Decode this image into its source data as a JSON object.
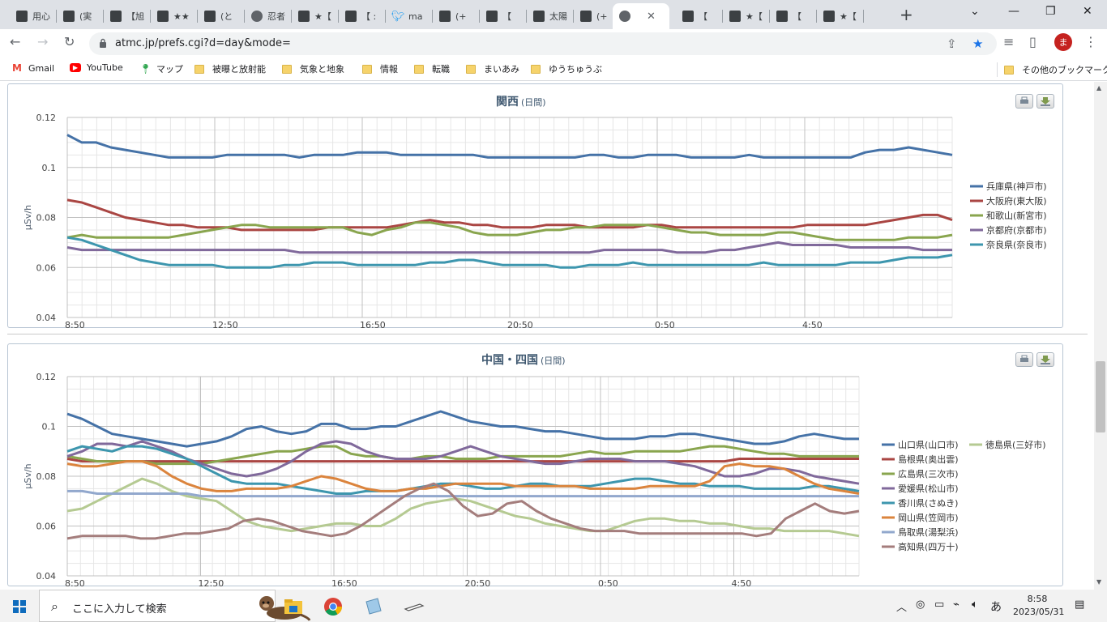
{
  "browser": {
    "tabs": [
      {
        "title": "用心",
        "icon": "site-icon"
      },
      {
        "title": "(実",
        "icon": "site-icon"
      },
      {
        "title": "【旭",
        "icon": "site-icon"
      },
      {
        "title": "★★",
        "icon": "site-icon"
      },
      {
        "title": "(と",
        "icon": "site-icon"
      },
      {
        "title": "忍者",
        "icon": "globe-icon"
      },
      {
        "title": "★【",
        "icon": "site-icon"
      },
      {
        "title": "【 :",
        "icon": "site-icon"
      },
      {
        "title": "ma",
        "icon": "twitter-icon"
      },
      {
        "title": "(+",
        "icon": "site-icon"
      },
      {
        "title": "【",
        "icon": "site-icon"
      },
      {
        "title": "太陽",
        "icon": "site-icon"
      },
      {
        "title": "(+",
        "icon": "site-icon"
      },
      {
        "title": "",
        "icon": "globe-icon",
        "active": true
      },
      {
        "title": "【",
        "icon": "site-icon"
      },
      {
        "title": "★【",
        "icon": "site-icon"
      },
      {
        "title": "【",
        "icon": "site-icon"
      },
      {
        "title": "★【",
        "icon": "site-icon"
      }
    ],
    "url": "atmc.jp/prefs.cgi?d=day&mode=",
    "avatar_initial": "ま",
    "bookmarks": [
      {
        "label": "Gmail",
        "icon": "gmail-icon"
      },
      {
        "label": "YouTube",
        "icon": "youtube-icon"
      },
      {
        "label": "マップ",
        "icon": "maps-icon"
      },
      {
        "label": "被曝と放射能",
        "icon": "folder-icon"
      },
      {
        "label": "気象と地象",
        "icon": "folder-icon"
      },
      {
        "label": "情報",
        "icon": "folder-icon"
      },
      {
        "label": "転職",
        "icon": "folder-icon"
      },
      {
        "label": "まいあみ",
        "icon": "folder-icon"
      },
      {
        "label": "ゆうちゅうぶ",
        "icon": "folder-icon"
      }
    ],
    "other_bookmarks": "その他のブックマーク"
  },
  "chart_data": [
    {
      "type": "line",
      "title": "関西",
      "subtitle": "(日間)",
      "ylabel": "μSv/h",
      "ylim": [
        0.04,
        0.12
      ],
      "yticks": [
        "0.12",
        "0.1",
        "0.08",
        "0.06",
        "0.04"
      ],
      "xticks": [
        "8:50",
        "12:50",
        "16:50",
        "20:50",
        "0:50",
        "4:50"
      ],
      "grid": true,
      "legend": "right",
      "series": [
        {
          "name": "兵庫県(神戸市)",
          "color": "#4572a7",
          "values": [
            0.113,
            0.11,
            0.11,
            0.108,
            0.107,
            0.106,
            0.105,
            0.104,
            0.104,
            0.104,
            0.104,
            0.105,
            0.105,
            0.105,
            0.105,
            0.105,
            0.104,
            0.105,
            0.105,
            0.105,
            0.106,
            0.106,
            0.106,
            0.105,
            0.105,
            0.105,
            0.105,
            0.105,
            0.105,
            0.104,
            0.104,
            0.104,
            0.104,
            0.104,
            0.104,
            0.104,
            0.105,
            0.105,
            0.104,
            0.104,
            0.105,
            0.105,
            0.105,
            0.104,
            0.104,
            0.104,
            0.104,
            0.105,
            0.104,
            0.104,
            0.104,
            0.104,
            0.104,
            0.104,
            0.104,
            0.106,
            0.107,
            0.107,
            0.108,
            0.107,
            0.106,
            0.105
          ]
        },
        {
          "name": "大阪府(東大阪)",
          "color": "#aa4643",
          "values": [
            0.087,
            0.086,
            0.084,
            0.082,
            0.08,
            0.079,
            0.078,
            0.077,
            0.077,
            0.076,
            0.076,
            0.076,
            0.075,
            0.075,
            0.075,
            0.075,
            0.075,
            0.075,
            0.076,
            0.076,
            0.076,
            0.076,
            0.076,
            0.077,
            0.078,
            0.079,
            0.078,
            0.078,
            0.077,
            0.077,
            0.076,
            0.076,
            0.076,
            0.077,
            0.077,
            0.077,
            0.076,
            0.076,
            0.076,
            0.076,
            0.077,
            0.077,
            0.076,
            0.076,
            0.076,
            0.076,
            0.076,
            0.076,
            0.076,
            0.076,
            0.076,
            0.077,
            0.077,
            0.077,
            0.077,
            0.077,
            0.078,
            0.079,
            0.08,
            0.081,
            0.081,
            0.079
          ]
        },
        {
          "name": "和歌山(新宮市)",
          "color": "#89a54e",
          "values": [
            0.072,
            0.073,
            0.072,
            0.072,
            0.072,
            0.072,
            0.072,
            0.072,
            0.073,
            0.074,
            0.075,
            0.076,
            0.077,
            0.077,
            0.076,
            0.076,
            0.076,
            0.076,
            0.076,
            0.076,
            0.074,
            0.073,
            0.075,
            0.076,
            0.078,
            0.078,
            0.077,
            0.076,
            0.074,
            0.073,
            0.073,
            0.073,
            0.074,
            0.075,
            0.075,
            0.076,
            0.076,
            0.077,
            0.077,
            0.077,
            0.077,
            0.076,
            0.075,
            0.074,
            0.074,
            0.073,
            0.073,
            0.073,
            0.073,
            0.074,
            0.074,
            0.073,
            0.072,
            0.071,
            0.071,
            0.071,
            0.071,
            0.071,
            0.072,
            0.072,
            0.072,
            0.073
          ]
        },
        {
          "name": "京都府(京都市)",
          "color": "#80699b",
          "values": [
            0.068,
            0.067,
            0.067,
            0.067,
            0.067,
            0.067,
            0.067,
            0.067,
            0.067,
            0.067,
            0.067,
            0.067,
            0.067,
            0.067,
            0.067,
            0.067,
            0.066,
            0.066,
            0.066,
            0.066,
            0.066,
            0.066,
            0.066,
            0.066,
            0.066,
            0.066,
            0.066,
            0.066,
            0.066,
            0.066,
            0.066,
            0.066,
            0.066,
            0.066,
            0.066,
            0.066,
            0.066,
            0.067,
            0.067,
            0.067,
            0.067,
            0.067,
            0.066,
            0.066,
            0.066,
            0.067,
            0.067,
            0.068,
            0.069,
            0.07,
            0.069,
            0.069,
            0.069,
            0.069,
            0.068,
            0.068,
            0.068,
            0.068,
            0.068,
            0.067,
            0.067,
            0.067
          ]
        },
        {
          "name": "奈良県(奈良市)",
          "color": "#3d96ae",
          "values": [
            0.072,
            0.071,
            0.069,
            0.067,
            0.065,
            0.063,
            0.062,
            0.061,
            0.061,
            0.061,
            0.061,
            0.06,
            0.06,
            0.06,
            0.06,
            0.061,
            0.061,
            0.062,
            0.062,
            0.062,
            0.061,
            0.061,
            0.061,
            0.061,
            0.061,
            0.062,
            0.062,
            0.063,
            0.063,
            0.062,
            0.061,
            0.061,
            0.061,
            0.061,
            0.06,
            0.06,
            0.061,
            0.061,
            0.061,
            0.062,
            0.061,
            0.061,
            0.061,
            0.061,
            0.061,
            0.061,
            0.061,
            0.061,
            0.062,
            0.061,
            0.061,
            0.061,
            0.061,
            0.061,
            0.062,
            0.062,
            0.062,
            0.063,
            0.064,
            0.064,
            0.064,
            0.065
          ]
        }
      ]
    },
    {
      "type": "line",
      "title": "中国・四国",
      "subtitle": "(日間)",
      "ylabel": "μSv/h",
      "ylim": [
        0.04,
        0.12
      ],
      "yticks": [
        "0.12",
        "0.1",
        "0.08",
        "0.06",
        "0.04"
      ],
      "xticks": [
        "8:50",
        "12:50",
        "16:50",
        "20:50",
        "0:50",
        "4:50"
      ],
      "grid": true,
      "legend": "right",
      "series": [
        {
          "name": "山口県(山口市)",
          "color": "#4572a7",
          "values": [
            0.105,
            0.103,
            0.1,
            0.097,
            0.096,
            0.095,
            0.094,
            0.093,
            0.092,
            0.093,
            0.094,
            0.096,
            0.099,
            0.1,
            0.098,
            0.097,
            0.098,
            0.101,
            0.101,
            0.099,
            0.099,
            0.1,
            0.1,
            0.102,
            0.104,
            0.106,
            0.104,
            0.102,
            0.101,
            0.1,
            0.1,
            0.099,
            0.098,
            0.098,
            0.097,
            0.096,
            0.095,
            0.095,
            0.095,
            0.096,
            0.096,
            0.097,
            0.097,
            0.096,
            0.095,
            0.094,
            0.093,
            0.093,
            0.094,
            0.096,
            0.097,
            0.096,
            0.095,
            0.095
          ]
        },
        {
          "name": "徳島県(三好市)",
          "color": "#b5ca92",
          "values": [
            0.066,
            0.067,
            0.07,
            0.073,
            0.076,
            0.079,
            0.077,
            0.074,
            0.072,
            0.071,
            0.07,
            0.066,
            0.062,
            0.06,
            0.059,
            0.058,
            0.059,
            0.06,
            0.061,
            0.061,
            0.06,
            0.06,
            0.063,
            0.067,
            0.069,
            0.07,
            0.071,
            0.07,
            0.068,
            0.066,
            0.064,
            0.063,
            0.061,
            0.06,
            0.059,
            0.058,
            0.058,
            0.06,
            0.062,
            0.063,
            0.063,
            0.062,
            0.062,
            0.061,
            0.061,
            0.06,
            0.059,
            0.059,
            0.058,
            0.058,
            0.058,
            0.058,
            0.057,
            0.056
          ]
        },
        {
          "name": "島根県(奥出雲)",
          "color": "#aa4643",
          "values": [
            0.087,
            0.086,
            0.086,
            0.086,
            0.086,
            0.086,
            0.086,
            0.086,
            0.086,
            0.086,
            0.086,
            0.086,
            0.086,
            0.086,
            0.086,
            0.086,
            0.086,
            0.086,
            0.086,
            0.086,
            0.086,
            0.086,
            0.086,
            0.086,
            0.086,
            0.086,
            0.086,
            0.086,
            0.086,
            0.086,
            0.086,
            0.086,
            0.086,
            0.086,
            0.086,
            0.086,
            0.086,
            0.086,
            0.086,
            0.086,
            0.086,
            0.086,
            0.086,
            0.086,
            0.086,
            0.087,
            0.087,
            0.087,
            0.087,
            0.087,
            0.087,
            0.087,
            0.087,
            0.087
          ]
        },
        {
          "name": "広島県(三次市)",
          "color": "#89a54e",
          "values": [
            0.088,
            0.087,
            0.086,
            0.086,
            0.086,
            0.086,
            0.085,
            0.085,
            0.085,
            0.085,
            0.086,
            0.087,
            0.088,
            0.089,
            0.09,
            0.09,
            0.091,
            0.092,
            0.092,
            0.089,
            0.088,
            0.088,
            0.087,
            0.087,
            0.088,
            0.088,
            0.087,
            0.087,
            0.087,
            0.088,
            0.088,
            0.088,
            0.088,
            0.088,
            0.089,
            0.09,
            0.089,
            0.089,
            0.09,
            0.09,
            0.09,
            0.09,
            0.091,
            0.092,
            0.092,
            0.091,
            0.09,
            0.089,
            0.089,
            0.088,
            0.088,
            0.088,
            0.088,
            0.088
          ]
        },
        {
          "name": "愛媛県(松山市)",
          "color": "#80699b",
          "values": [
            0.088,
            0.09,
            0.093,
            0.093,
            0.092,
            0.094,
            0.092,
            0.09,
            0.087,
            0.085,
            0.083,
            0.081,
            0.08,
            0.081,
            0.083,
            0.086,
            0.09,
            0.093,
            0.094,
            0.093,
            0.09,
            0.088,
            0.087,
            0.087,
            0.087,
            0.088,
            0.09,
            0.092,
            0.09,
            0.088,
            0.087,
            0.086,
            0.085,
            0.085,
            0.086,
            0.087,
            0.087,
            0.087,
            0.086,
            0.086,
            0.086,
            0.085,
            0.084,
            0.082,
            0.08,
            0.08,
            0.081,
            0.083,
            0.083,
            0.082,
            0.08,
            0.079,
            0.078,
            0.077
          ]
        },
        {
          "name": "香川県(さぬき)",
          "color": "#3d96ae",
          "values": [
            0.09,
            0.092,
            0.091,
            0.09,
            0.092,
            0.092,
            0.091,
            0.089,
            0.087,
            0.084,
            0.081,
            0.078,
            0.077,
            0.077,
            0.077,
            0.076,
            0.075,
            0.074,
            0.073,
            0.073,
            0.074,
            0.074,
            0.074,
            0.075,
            0.076,
            0.077,
            0.077,
            0.076,
            0.075,
            0.075,
            0.076,
            0.077,
            0.077,
            0.076,
            0.076,
            0.076,
            0.077,
            0.078,
            0.079,
            0.079,
            0.078,
            0.077,
            0.077,
            0.076,
            0.076,
            0.076,
            0.075,
            0.075,
            0.075,
            0.075,
            0.076,
            0.076,
            0.075,
            0.074
          ]
        },
        {
          "name": "岡山県(笠岡市)",
          "color": "#db843d",
          "values": [
            0.085,
            0.084,
            0.084,
            0.085,
            0.086,
            0.086,
            0.084,
            0.08,
            0.077,
            0.075,
            0.074,
            0.074,
            0.075,
            0.075,
            0.075,
            0.076,
            0.078,
            0.08,
            0.079,
            0.077,
            0.075,
            0.074,
            0.074,
            0.075,
            0.075,
            0.076,
            0.077,
            0.077,
            0.077,
            0.077,
            0.076,
            0.076,
            0.076,
            0.076,
            0.076,
            0.075,
            0.075,
            0.075,
            0.075,
            0.076,
            0.076,
            0.076,
            0.076,
            0.078,
            0.084,
            0.085,
            0.084,
            0.084,
            0.083,
            0.08,
            0.077,
            0.075,
            0.074,
            0.073
          ]
        },
        {
          "name": "鳥取県(湯梨浜)",
          "color": "#92a8cd",
          "values": [
            0.074,
            0.074,
            0.073,
            0.073,
            0.073,
            0.073,
            0.073,
            0.073,
            0.073,
            0.072,
            0.072,
            0.072,
            0.072,
            0.072,
            0.072,
            0.072,
            0.072,
            0.072,
            0.072,
            0.072,
            0.072,
            0.072,
            0.072,
            0.072,
            0.072,
            0.072,
            0.072,
            0.072,
            0.072,
            0.072,
            0.072,
            0.072,
            0.072,
            0.072,
            0.072,
            0.072,
            0.072,
            0.072,
            0.072,
            0.072,
            0.072,
            0.072,
            0.072,
            0.072,
            0.072,
            0.072,
            0.072,
            0.072,
            0.072,
            0.072,
            0.072,
            0.072,
            0.072,
            0.072
          ]
        },
        {
          "name": "高知県(四万十)",
          "color": "#a47d7c",
          "values": [
            0.055,
            0.056,
            0.056,
            0.056,
            0.056,
            0.055,
            0.055,
            0.056,
            0.057,
            0.057,
            0.058,
            0.059,
            0.062,
            0.063,
            0.062,
            0.06,
            0.058,
            0.057,
            0.056,
            0.057,
            0.06,
            0.064,
            0.068,
            0.072,
            0.075,
            0.077,
            0.074,
            0.068,
            0.064,
            0.065,
            0.069,
            0.07,
            0.066,
            0.063,
            0.061,
            0.059,
            0.058,
            0.058,
            0.058,
            0.057,
            0.057,
            0.057,
            0.057,
            0.057,
            0.057,
            0.057,
            0.057,
            0.056,
            0.057,
            0.063,
            0.066,
            0.069,
            0.066,
            0.065,
            0.066
          ]
        }
      ]
    }
  ],
  "taskbar": {
    "search_placeholder": "ここに入力して検索",
    "time": "8:58",
    "date": "2023/05/31",
    "ime": "あ"
  }
}
